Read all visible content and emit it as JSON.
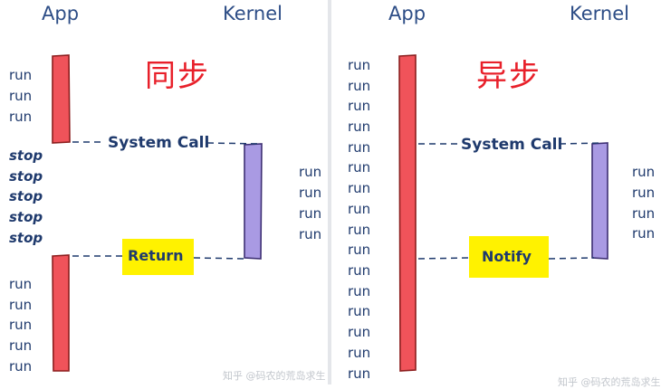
{
  "left": {
    "app_label": "App",
    "kernel_label": "Kernel",
    "title": "同步",
    "app_words_before": [
      "run",
      "run",
      "run"
    ],
    "app_words_stop": [
      "stop",
      "stop",
      "stop",
      "stop",
      "stop"
    ],
    "app_words_after": [
      "run",
      "run",
      "run",
      "run",
      "run"
    ],
    "kernel_words": [
      "run",
      "run",
      "run",
      "run"
    ],
    "call_label": "System Call",
    "return_label": "Return",
    "watermark": "知乎 @码农的荒岛求生"
  },
  "right": {
    "app_label": "App",
    "kernel_label": "Kernel",
    "title": "异步",
    "app_words": [
      "run",
      "run",
      "run",
      "run",
      "run",
      "run",
      "run",
      "run",
      "run",
      "run",
      "run",
      "run",
      "run",
      "run",
      "run",
      "run"
    ],
    "kernel_words": [
      "run",
      "run",
      "run",
      "run"
    ],
    "call_label": "System Call",
    "notify_label": "Notify",
    "watermark": "知乎 @码农的荒岛求生"
  },
  "colors": {
    "app_bar": "#f0535a",
    "kernel_bar": "#a99ae3",
    "highlight": "#fff200",
    "title": "#e8202a",
    "text": "#1f3a6d"
  }
}
